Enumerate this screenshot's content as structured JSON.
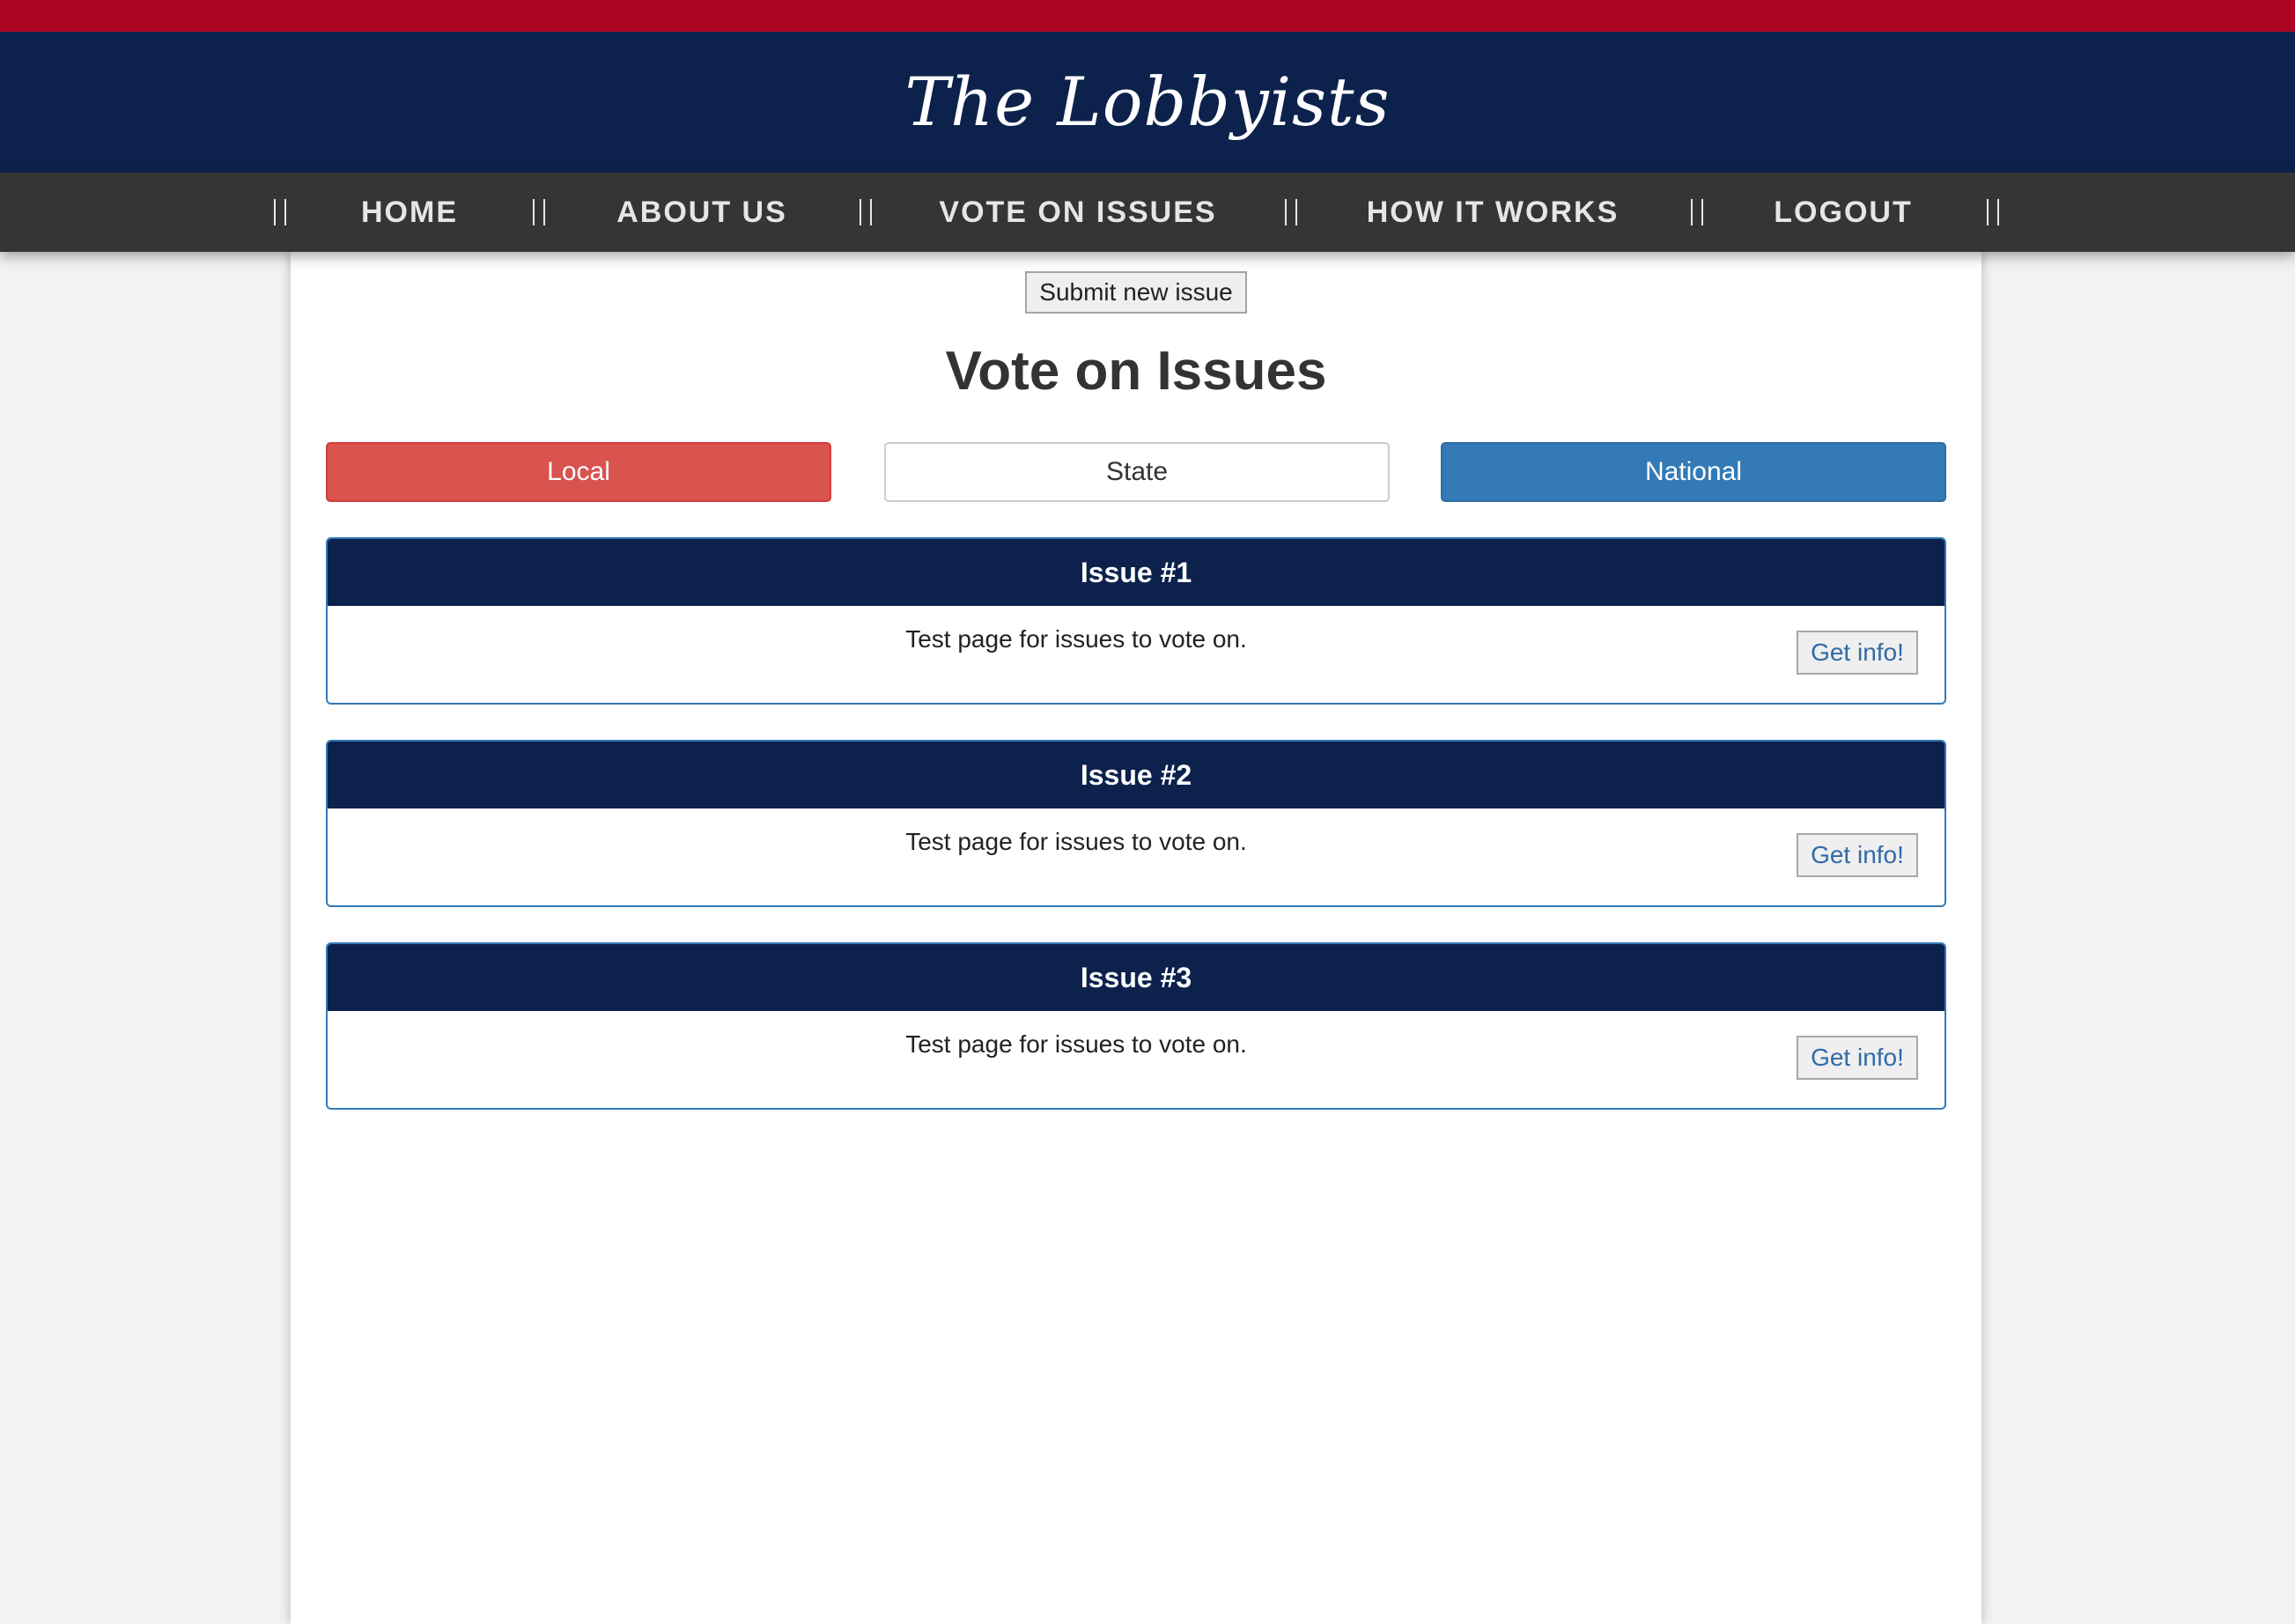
{
  "site": {
    "logo_text": "The Lobbyists"
  },
  "nav": {
    "items": [
      {
        "label": "HOME"
      },
      {
        "label": "ABOUT US"
      },
      {
        "label": "VOTE ON ISSUES"
      },
      {
        "label": "HOW IT WORKS"
      },
      {
        "label": "LOGOUT"
      }
    ]
  },
  "main": {
    "submit_label": "Submit new issue",
    "title": "Vote on Issues",
    "filters": {
      "local": "Local",
      "state": "State",
      "national": "National"
    },
    "issues": [
      {
        "title": "Issue #1",
        "body": "Test page for issues to vote on.",
        "button": "Get info!"
      },
      {
        "title": "Issue #2",
        "body": "Test page for issues to vote on.",
        "button": "Get info!"
      },
      {
        "title": "Issue #3",
        "body": "Test page for issues to vote on.",
        "button": "Get info!"
      }
    ]
  },
  "colors": {
    "top_stripe": "#ad0521",
    "header_navy": "#0c224c",
    "nav_dark": "#353535",
    "danger": "#d9534f",
    "primary": "#337ab7"
  }
}
